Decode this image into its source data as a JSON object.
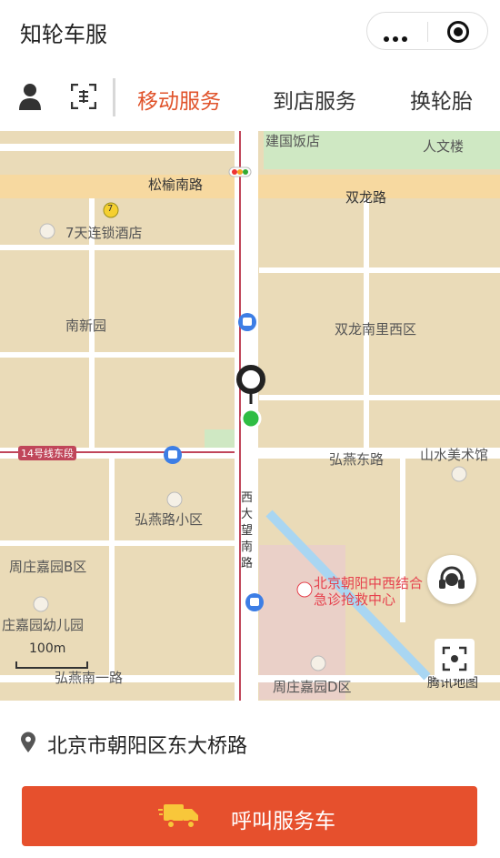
{
  "app": {
    "title": "知轮车服"
  },
  "nav": {
    "tabs": [
      {
        "label": "移动服务",
        "active": true
      },
      {
        "label": "到店服务",
        "active": false
      },
      {
        "label": "换轮胎",
        "active": false
      }
    ]
  },
  "map": {
    "labels": {
      "jianguo_hotel": "建国饭店",
      "renwen_building": "人文楼",
      "songyu_south_road": "松榆南路",
      "shuanglong_road": "双龙路",
      "hotel_7days": "7天连锁酒店",
      "nanxin_garden": "南新园",
      "shuanglong_nanli_west": "双龙南里西区",
      "line14_east": "14号线东段",
      "hongyan_east_road": "弘燕东路",
      "shanshui_museum": "山水美术馆",
      "hongyan_community": "弘燕路小区",
      "xidawang_road": "西大望南路",
      "zhouzhuang_b": "周庄嘉园B区",
      "emergency_center": "北京朝阳中西结合急诊抢救中心",
      "zhouzhuang_kindergarten": "庄嘉园幼儿园",
      "hongyan_south_1": "弘燕南一路",
      "zhouzhuang_d": "周庄嘉园D区",
      "tencent_map": "腾讯地图",
      "metro_badge": "7",
      "scale": "100m"
    },
    "colors": {
      "land": "#eadbb8",
      "road": "#ffffff",
      "major_road": "#f7d9a0",
      "green": "#cfe8c3",
      "water": "#a9d6f2",
      "metro_line": "#c0465a",
      "accent": "#e6502d"
    }
  },
  "address": {
    "text": "北京市朝阳区东大桥路"
  },
  "action": {
    "call_label": "呼叫服务车"
  },
  "icons": [
    "more-icon",
    "close-icon",
    "user-icon",
    "scan-icon",
    "location-pin-icon",
    "customer-service-icon",
    "locate-icon",
    "truck-icon",
    "bus-stop-icon"
  ]
}
